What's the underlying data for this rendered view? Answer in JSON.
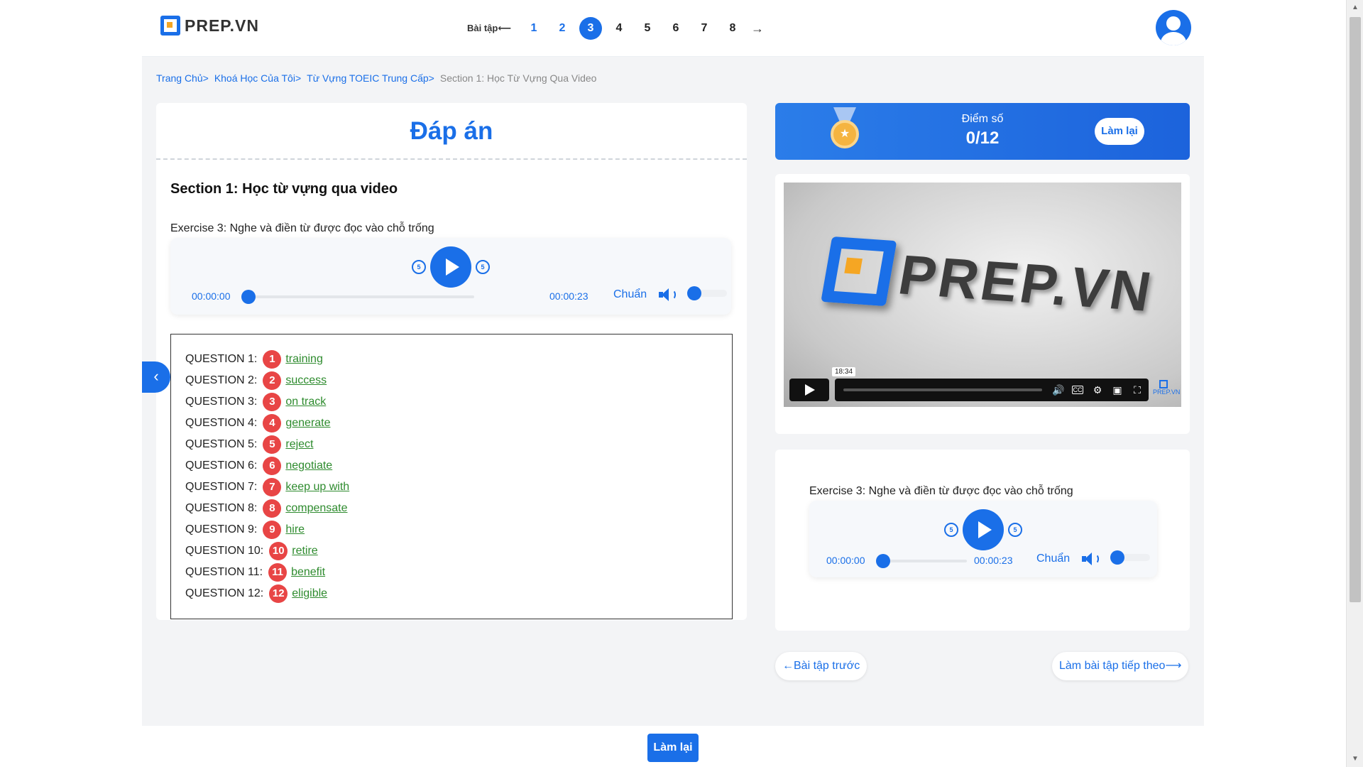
{
  "header": {
    "logo_text": "PREP.VN",
    "exercise_label": "Bài tập",
    "exercise_arrow": "⟵",
    "exercises": [
      "1",
      "2",
      "3",
      "4",
      "5",
      "6",
      "7",
      "8"
    ],
    "active_exercise": "3",
    "next_arrow": "→"
  },
  "breadcrumb": {
    "items": [
      "Trang Chủ",
      "Khoá Học Của Tôi",
      "Từ Vựng TOEIC Trung Cấp"
    ],
    "current": "Section 1: Học Từ Vựng Qua Video",
    "separator": ">"
  },
  "left": {
    "title": "Đáp án",
    "section_title": "Section 1: Học từ vựng qua video",
    "exercise_label": "Exercise 3: Nghe và điền từ được đọc vào chỗ trống",
    "player": {
      "current_time": "00:00:00",
      "duration": "00:00:23",
      "speed": "Chuẩn",
      "skip": "5"
    },
    "questions": [
      {
        "label": "QUESTION 1:",
        "num": "1",
        "answer": "training"
      },
      {
        "label": "QUESTION 2:",
        "num": "2",
        "answer": "success"
      },
      {
        "label": "QUESTION 3:",
        "num": "3",
        "answer": "on track"
      },
      {
        "label": "QUESTION 4:",
        "num": "4",
        "answer": "generate"
      },
      {
        "label": "QUESTION 5:",
        "num": "5",
        "answer": "reject"
      },
      {
        "label": "QUESTION 6:",
        "num": "6",
        "answer": "negotiate"
      },
      {
        "label": "QUESTION 7:",
        "num": "7",
        "answer": "keep up with"
      },
      {
        "label": "QUESTION 8:",
        "num": "8",
        "answer": "compensate"
      },
      {
        "label": "QUESTION 9:",
        "num": "9",
        "answer": "hire"
      },
      {
        "label": "QUESTION 10:",
        "num": "10",
        "answer": "retire"
      },
      {
        "label": "QUESTION 11:",
        "num": "11",
        "answer": "benefit"
      },
      {
        "label": "QUESTION 12:",
        "num": "12",
        "answer": "eligible"
      }
    ]
  },
  "score": {
    "label": "Điểm số",
    "value": "0/12",
    "retry": "Làm lại"
  },
  "video": {
    "logo_text": "PREP.VN",
    "hover_time": "18:34",
    "watermark": "PREP.VN"
  },
  "audio": {
    "exercise_label": "Exercise 3: Nghe và điền từ được đọc vào chỗ trống",
    "player": {
      "current_time": "00:00:00",
      "duration": "00:00:23",
      "speed": "Chuẩn",
      "skip": "5"
    }
  },
  "nav": {
    "prev": "Bài tập trước",
    "next": "Làm bài tập tiếp theo",
    "prev_arrow": "←",
    "next_arrow": "⟶"
  },
  "footer": {
    "retry": "Làm lại"
  },
  "colors": {
    "primary": "#1a6fe8",
    "accent": "#f5a623",
    "answer": "#2e8b2e",
    "badge": "#e84545"
  },
  "icons": {
    "back": "chevron-left-icon",
    "replay": "replay-5-icon",
    "forward": "forward-5-icon",
    "volume": "volume-icon"
  }
}
